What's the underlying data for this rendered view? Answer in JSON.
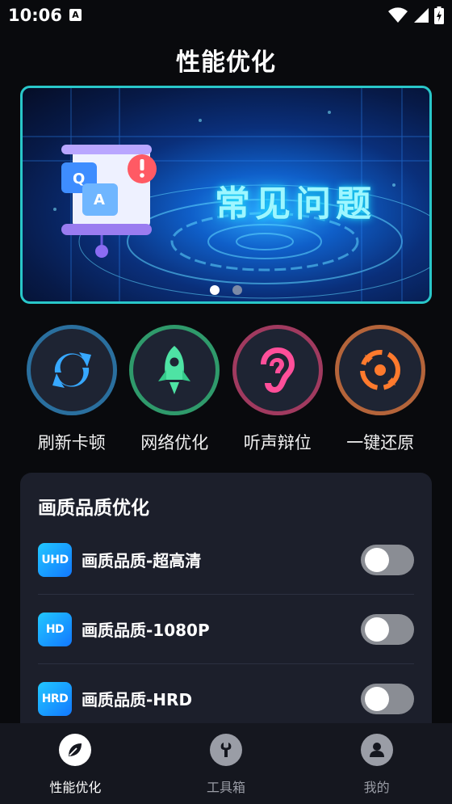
{
  "status_bar": {
    "time": "10:06",
    "notification_glyph": "A",
    "icons": [
      "wifi-icon",
      "signal-icon",
      "battery-charging-icon"
    ]
  },
  "page_title": "性能优化",
  "banner": {
    "headline": "常见问题",
    "illustration": "qa-chat-icon",
    "slide_count": 2,
    "active_slide": 1
  },
  "quick_actions": [
    {
      "label": "刷新卡顿",
      "icon": "refresh-icon",
      "color": "#2a6f9e"
    },
    {
      "label": "网络优化",
      "icon": "rocket-icon",
      "color": "#2f9a6b"
    },
    {
      "label": "听声辩位",
      "icon": "ear-icon",
      "color": "#a03a5f"
    },
    {
      "label": "一键还原",
      "icon": "restore-icon",
      "color": "#b4643a"
    }
  ],
  "quality_card": {
    "title": "画质品质优化",
    "items": [
      {
        "badge": "UHD",
        "label": "画质品质-超高清",
        "enabled": false
      },
      {
        "badge": "HD",
        "label": "画质品质-1080P",
        "enabled": false
      },
      {
        "badge": "HRD",
        "label": "画质品质-HRD",
        "enabled": false
      }
    ]
  },
  "bottom_nav": [
    {
      "label": "性能优化",
      "icon": "leaf-icon",
      "active": true
    },
    {
      "label": "工具箱",
      "icon": "wrench-icon",
      "active": false
    },
    {
      "label": "我的",
      "icon": "user-icon",
      "active": false
    }
  ],
  "colors": {
    "background": "#090a0d",
    "card": "#1c1f2b",
    "banner_border": "#29c7c9",
    "toggle_off": "#8a8d94",
    "nav_active": "#ffffff",
    "nav_inactive": "#9a9da6"
  }
}
